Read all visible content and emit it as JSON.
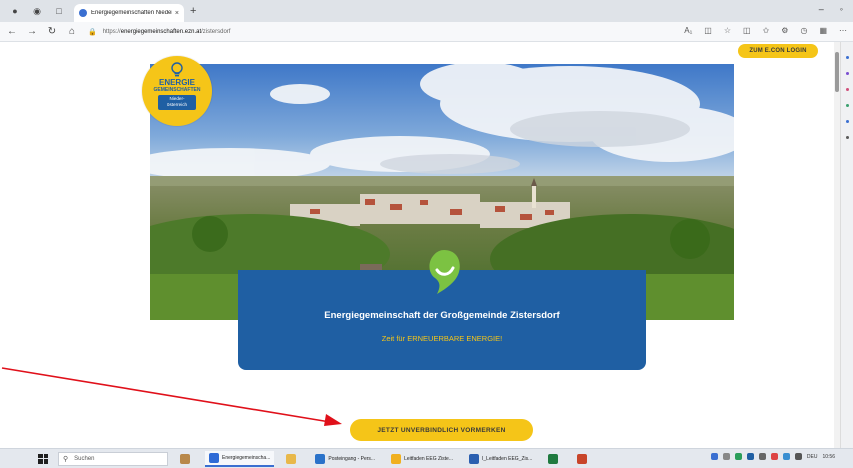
{
  "browser": {
    "tab_title": "Energiegemeinschaften Niederö",
    "tab_close": "×",
    "new_tab": "+",
    "url_prefix": "https://",
    "url_host": "energiegemeinschaften.ezn.at",
    "url_path": "/zistersdorf"
  },
  "page": {
    "login_button": "ZUM E.CON LOGIN",
    "logo": {
      "line1": "ENERGIE",
      "line2": "GEMEINSCHAFTEN",
      "region_line1": "Nieder-",
      "region_line2": "österreich"
    },
    "card": {
      "title": "Energiegemeinschaft der Großgemeinde Zistersdorf",
      "subtitle": "Zeit für ERNEUERBARE ENERGIE!"
    },
    "cta_button": "JETZT UNVERBINDLICH VORMERKEN"
  },
  "taskbar": {
    "search_placeholder": "Suchen",
    "apps": [
      {
        "label": "Energiegemeinscha...",
        "color": "#2f6bd6"
      },
      {
        "label": "Posteingang - Pers...",
        "color": "#2a72c9"
      },
      {
        "label": "Leitfaden EEG Ziste...",
        "color": "#f0b020"
      },
      {
        "label": "I_Leitfaden EEG_Zis...",
        "color": "#2b5fb0"
      }
    ],
    "lang": "DEU",
    "time": "10:56"
  },
  "colors": {
    "brand_blue": "#1f5fa3",
    "brand_yellow": "#f5c518",
    "leaf_green": "#7cc242",
    "arrow_red": "#e0101a"
  }
}
